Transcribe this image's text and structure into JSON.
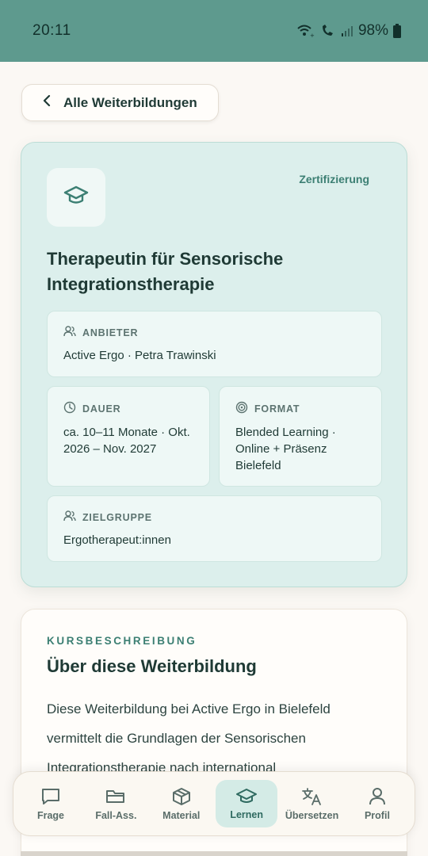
{
  "status_bar": {
    "time": "20:11",
    "battery": "98%",
    "icons": [
      "wifi-call-icon",
      "phone-call-icon",
      "signal-icon",
      "battery-icon"
    ]
  },
  "back_button": {
    "label": "Alle Weiterbildungen",
    "icon": "chevron-left-icon"
  },
  "course": {
    "icon": "graduation-cap-icon",
    "category": "Zertifizierung",
    "title": "Therapeutin für Sensorische Integrationstherapie",
    "provider": {
      "label": "ANBIETER",
      "value": "Active Ergo · Petra Trawinski",
      "icon": "users-icon"
    },
    "duration": {
      "label": "DAUER",
      "value": "ca. 10–11 Monate · Okt. 2026 – Nov. 2027",
      "icon": "clock-icon"
    },
    "format": {
      "label": "FORMAT",
      "value": "Blended Learning · Online + Präsenz Bielefeld",
      "icon": "target-icon"
    },
    "audience": {
      "label": "ZIELGRUPPE",
      "value": "Ergotherapeut:innen",
      "icon": "users-icon"
    }
  },
  "description": {
    "eyebrow": "KURSBESCHREIBUNG",
    "heading": "Über diese Weiterbildung",
    "text": "Diese Weiterbildung bei Active Ergo in Bielefeld vermittelt die Grundlagen der Sensorischen Integrationstherapie nach international"
  },
  "nav": {
    "items": [
      {
        "label": "Frage",
        "icon": "chat-icon",
        "active": false
      },
      {
        "label": "Fall-Ass.",
        "icon": "folder-icon",
        "active": false
      },
      {
        "label": "Material",
        "icon": "box-icon",
        "active": false
      },
      {
        "label": "Lernen",
        "icon": "graduation-cap-icon",
        "active": true
      },
      {
        "label": "Übersetzen",
        "icon": "translate-icon",
        "active": false
      },
      {
        "label": "Profil",
        "icon": "user-icon",
        "active": false
      }
    ]
  },
  "colors": {
    "status_bar": "#5e9a8e",
    "accent": "#3c7f73",
    "card_bg": "#dcefec",
    "active_nav_bg": "#d4ebe6"
  }
}
